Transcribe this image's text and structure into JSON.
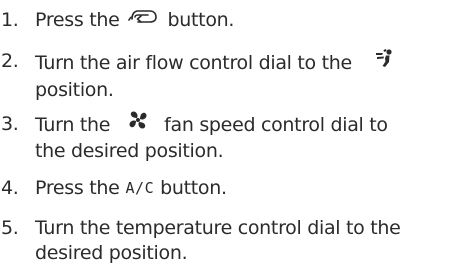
{
  "steps": [
    {
      "number": "1.",
      "before": "Press the",
      "icon": "recirculation-icon",
      "after": "button."
    },
    {
      "number": "2.",
      "line1": "Turn the air flow control dial to the",
      "icon": "foot-defrost-mode-icon",
      "line2": "position."
    },
    {
      "number": "3.",
      "before": "Turn the",
      "icon": "fan-icon",
      "after": "fan speed control dial to",
      "line2": "the desired position."
    },
    {
      "number": "4.",
      "before": "Press the",
      "button_label": "A/C",
      "after": "button."
    },
    {
      "number": "5.",
      "line1": "Turn the temperature control dial to the",
      "line2": "desired position."
    }
  ]
}
